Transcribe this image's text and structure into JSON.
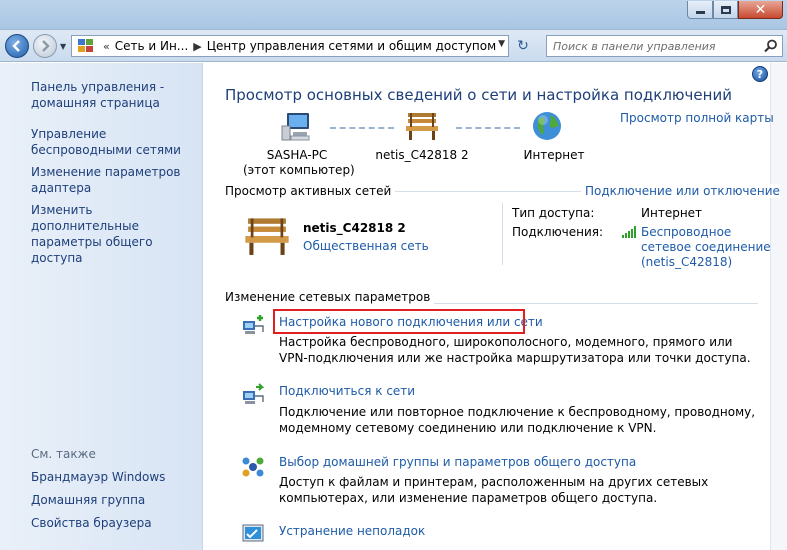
{
  "navbar": {
    "breadcrumb": [
      "Сеть и Ин...",
      "Центр управления сетями и общим доступом"
    ],
    "search_placeholder": "Поиск в панели управления"
  },
  "sidebar": {
    "links": [
      "Панель управления - домашняя страница",
      "Управление беспроводными сетями",
      "Изменение параметров адаптера",
      "Изменить дополнительные параметры общего доступа"
    ],
    "see_also_title": "См. также",
    "see_also": [
      "Брандмауэр Windows",
      "Домашняя группа",
      "Свойства браузера"
    ]
  },
  "main": {
    "title": "Просмотр основных сведений о сети и настройка подключений",
    "full_map_link": "Просмотр полной карты",
    "map": {
      "computer_name": "SASHA-PC",
      "computer_sub": "(этот компьютер)",
      "network_name": "netis_C42818  2",
      "internet": "Интернет"
    },
    "active_title": "Просмотр активных сетей",
    "connect_disconnect_link": "Подключение или отключение",
    "active_network": {
      "name": "netis_C42818  2",
      "type_link": "Общественная сеть",
      "access_label": "Тип доступа:",
      "access_value": "Интернет",
      "connections_label": "Подключения:",
      "connection_link": [
        "Беспроводное",
        "сетевое соединение",
        "(netis_C42818)"
      ]
    },
    "change_title": "Изменение сетевых параметров",
    "tasks": [
      {
        "title": "Настройка нового подключения или сети",
        "desc": "Настройка беспроводного, широкополосного, модемного, прямого или VPN-подключения или же настройка маршрутизатора или точки доступа."
      },
      {
        "title": "Подключиться к сети",
        "desc": "Подключение или повторное подключение к беспроводному, проводному, модемному сетевому соединению или подключение к VPN."
      },
      {
        "title": "Выбор домашней группы и параметров общего доступа",
        "desc": "Доступ к файлам и принтерам, расположенным на других сетевых компьютерах, или изменение параметров общего доступа."
      },
      {
        "title": "Устранение неполадок",
        "desc": ""
      }
    ]
  }
}
